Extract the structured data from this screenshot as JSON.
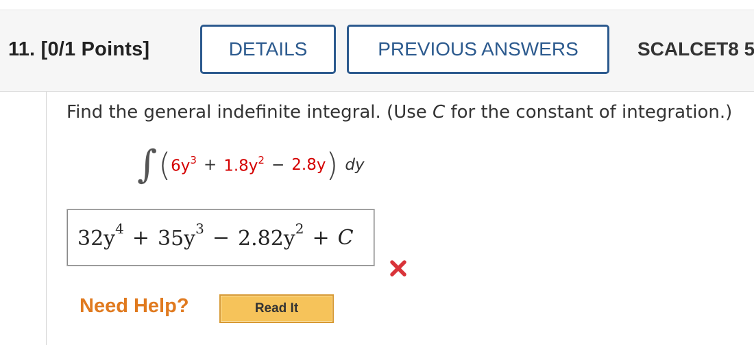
{
  "question": {
    "number_label": "11.",
    "points_label": "[0/1 Points]",
    "course_label": "SCALCET8 5"
  },
  "toolbar": {
    "details_label": "DETAILS",
    "previous_answers_label": "PREVIOUS ANSWERS"
  },
  "prompt": {
    "text_before": "Find the general indefinite integral. (Use ",
    "variable": "C",
    "text_after": " for the constant of integration.)"
  },
  "integral": {
    "sign": "∫",
    "open_paren": "(",
    "term1_coef": "6y",
    "term1_exp": "3",
    "op1": "+",
    "term2_coef": "1.8y",
    "term2_exp": "2",
    "op2": "−",
    "term3": "2.8y",
    "close_paren": ")",
    "differential": "dy",
    "highlight_color": "#d40000"
  },
  "answer": {
    "t1_coef": "32y",
    "t1_exp": "4",
    "op1": "+",
    "t2_coef": "35y",
    "t2_exp": "3",
    "op2": "−",
    "t3_coef": "2.82y",
    "t3_exp": "2",
    "op3": "+",
    "constant": "C",
    "status": "incorrect",
    "status_icon": "x-mark-icon"
  },
  "help": {
    "label": "Need Help?",
    "read_it_label": "Read It"
  },
  "colors": {
    "accent": "#2c5a8e",
    "help_orange": "#e07a1f",
    "button_yellow": "#f6c35a",
    "error_red": "#d9343a"
  }
}
